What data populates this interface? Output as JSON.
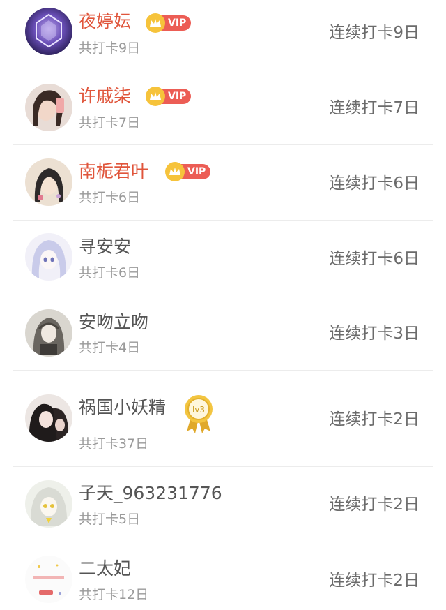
{
  "rows": [
    {
      "name": "夜婷妘",
      "vip": true,
      "total": "共打卡9日",
      "streak": "连续打卡9日",
      "avatar": "avatar-1"
    },
    {
      "name": "许戚柒",
      "vip": true,
      "total": "共打卡7日",
      "streak": "连续打卡7日",
      "avatar": "avatar-2"
    },
    {
      "name": "南栀君叶",
      "vip": true,
      "total": "共打卡6日",
      "streak": "连续打卡6日",
      "avatar": "avatar-3"
    },
    {
      "name": "寻安安",
      "vip": false,
      "total": "共打卡6日",
      "streak": "连续打卡6日",
      "avatar": "avatar-4"
    },
    {
      "name": "安吻立吻",
      "vip": false,
      "total": "共打卡4日",
      "streak": "连续打卡3日",
      "avatar": "avatar-5"
    },
    {
      "name": "祸国小妖精",
      "vip": false,
      "level": "lv3",
      "total": "共打卡37日",
      "streak": "连续打卡2日",
      "avatar": "avatar-6"
    },
    {
      "name": "子天_963231776",
      "vip": false,
      "total": "共打卡5日",
      "streak": "连续打卡2日",
      "avatar": "avatar-7"
    },
    {
      "name": "二太妃",
      "vip": false,
      "total": "共打卡12日",
      "streak": "连续打卡2日",
      "avatar": "avatar-8"
    }
  ],
  "vip_label": "VIP",
  "colors": {
    "vip_name": "#e0553b",
    "name": "#555555",
    "sub": "#9a9a9a",
    "streak": "#6b6b6b",
    "vip_pill": "#ec5d55",
    "crown": "#f6c33b"
  }
}
